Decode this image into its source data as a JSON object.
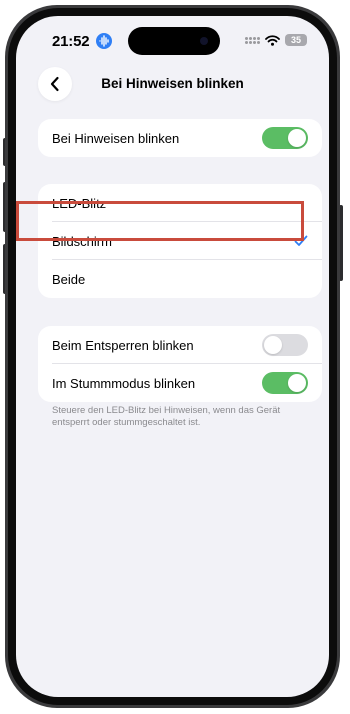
{
  "status_bar": {
    "time": "21:52",
    "battery": "35"
  },
  "nav": {
    "title": "Bei Hinweisen blinken"
  },
  "flash_toggle": {
    "label": "Bei Hinweisen blinken",
    "state": "on"
  },
  "flash_type": {
    "options": [
      "LED-Blitz",
      "Bildschirm",
      "Beide"
    ],
    "selected": "Bildschirm"
  },
  "conditions": {
    "items": [
      {
        "label": "Beim Entsperren blinken",
        "state": "off"
      },
      {
        "label": "Im Stummmodus blinken",
        "state": "on"
      }
    ],
    "footnote": "Steuere den LED-Blitz bei Hinweisen, wenn das Gerät entsperrt oder stummgeschaltet ist."
  },
  "colors": {
    "toggle_on": "#5bbd64",
    "toggle_off": "#dcdce0",
    "checkmark": "#2f7ff5",
    "highlight_box": "#c94b3c"
  },
  "icons": {
    "back": "chevron-left-icon",
    "check": "checkmark-icon",
    "siri": "siri-waveform-icon",
    "cellular": "cellular-dots-icon",
    "wifi": "wifi-icon"
  }
}
